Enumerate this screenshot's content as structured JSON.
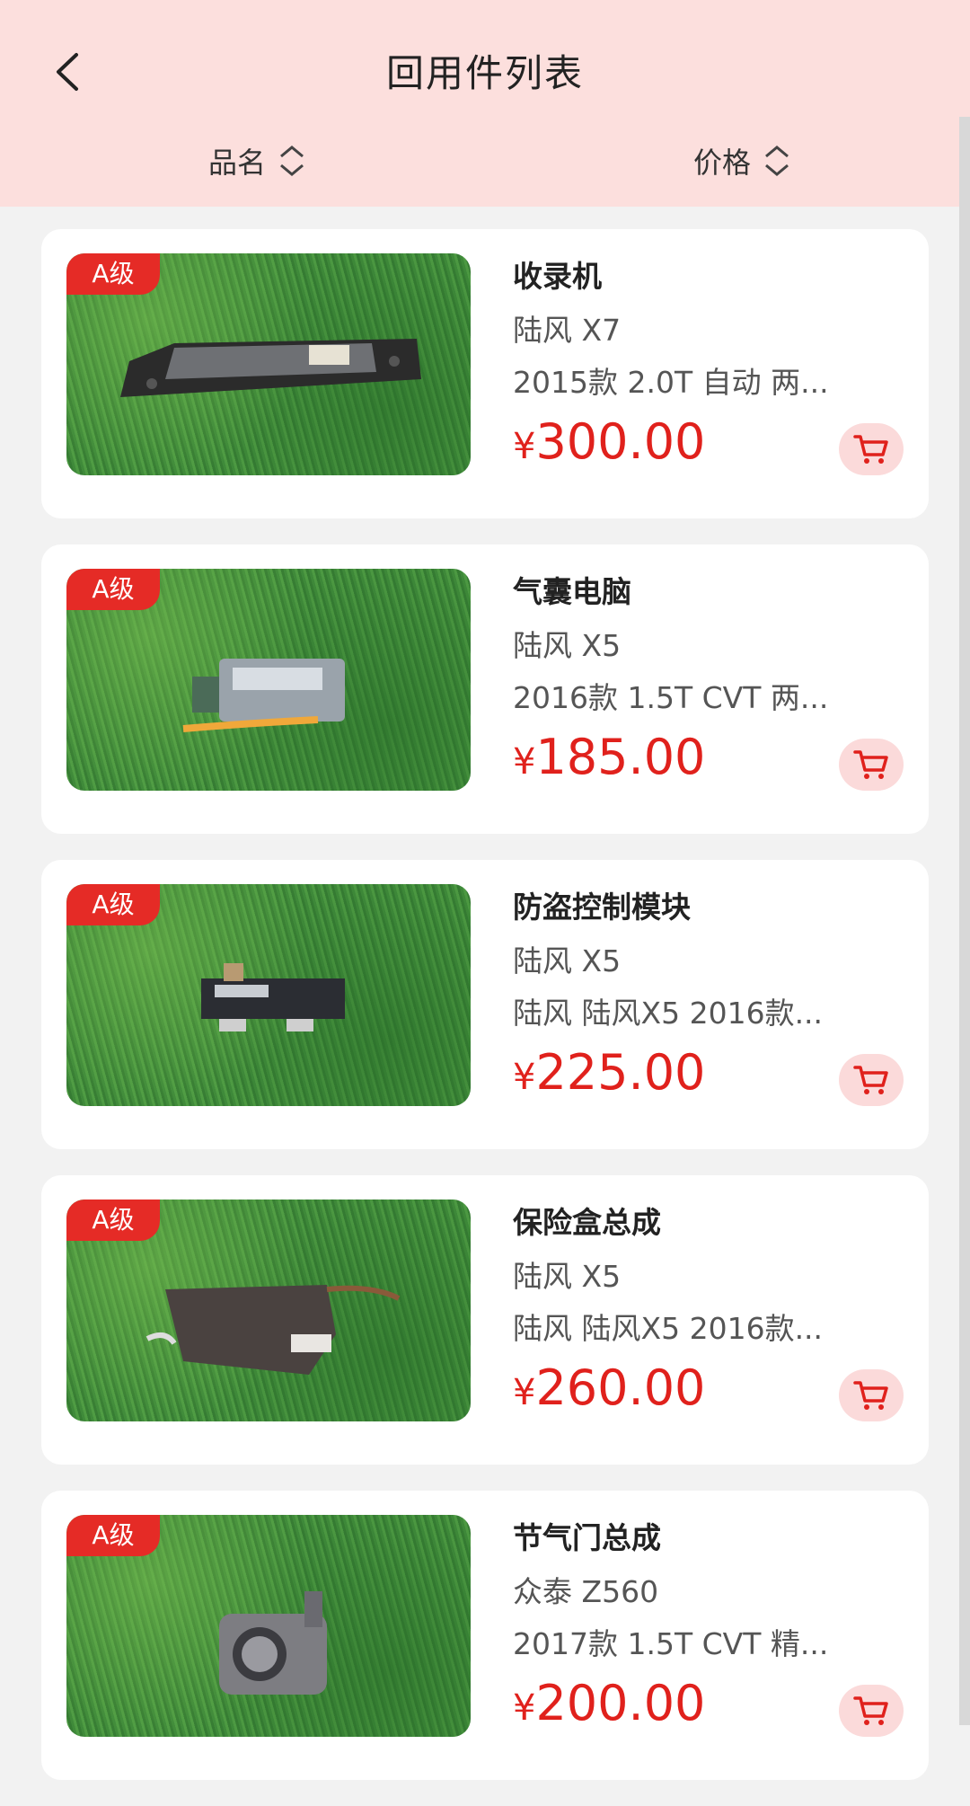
{
  "header": {
    "title": "回用件列表",
    "back_icon": "chevron-left-icon",
    "sort_name_label": "品名",
    "sort_price_label": "价格"
  },
  "colors": {
    "accent": "#e0211c",
    "header_bg": "#fcdfdd",
    "badge": "#e52b26",
    "cart_bg": "#fbdada"
  },
  "items": [
    {
      "grade": "A级",
      "name": "收录机",
      "model": "陆风 X7",
      "desc": "2015款 2.0T 自动 两...",
      "currency": "¥",
      "price": "300.00",
      "cart_icon": "cart-icon"
    },
    {
      "grade": "A级",
      "name": "气囊电脑",
      "model": "陆风 X5",
      "desc": "2016款 1.5T CVT 两...",
      "currency": "¥",
      "price": "185.00",
      "cart_icon": "cart-icon"
    },
    {
      "grade": "A级",
      "name": "防盗控制模块",
      "model": "陆风 X5",
      "desc": "陆风 陆风X5 2016款...",
      "currency": "¥",
      "price": "225.00",
      "cart_icon": "cart-icon"
    },
    {
      "grade": "A级",
      "name": "保险盒总成",
      "model": "陆风 X5",
      "desc": "陆风 陆风X5 2016款...",
      "currency": "¥",
      "price": "260.00",
      "cart_icon": "cart-icon"
    },
    {
      "grade": "A级",
      "name": "节气门总成",
      "model": "众泰 Z560",
      "desc": "2017款 1.5T CVT 精...",
      "currency": "¥",
      "price": "200.00",
      "cart_icon": "cart-icon"
    }
  ]
}
